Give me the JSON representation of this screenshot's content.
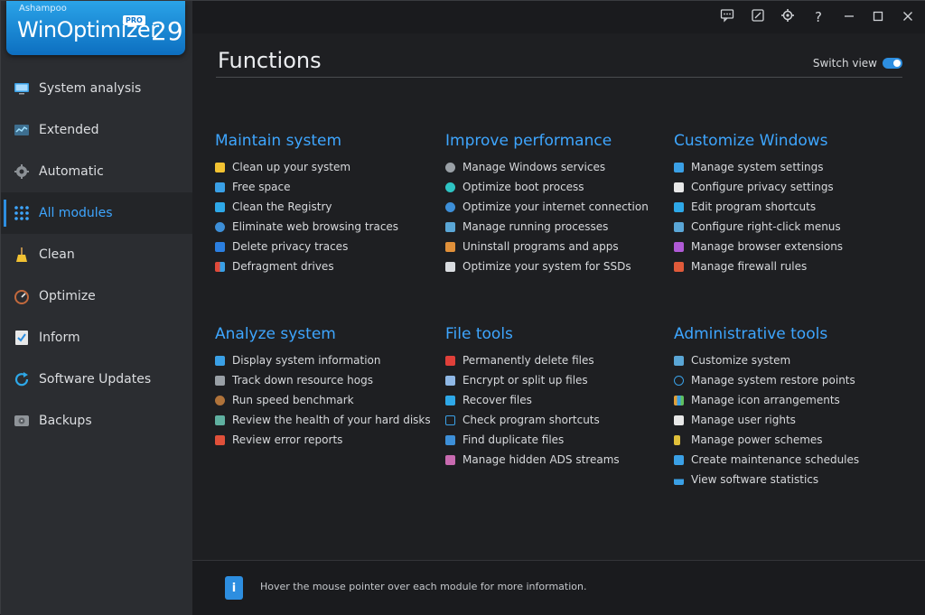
{
  "logo": {
    "brand": "Ashampoo",
    "product": "WinOptimizer",
    "badge": "PRO",
    "version": "29"
  },
  "sidebar": {
    "items": [
      {
        "label": "System analysis",
        "icon": "monitor-icon",
        "active": false
      },
      {
        "label": "Extended",
        "icon": "chart-icon",
        "active": false
      },
      {
        "label": "Automatic",
        "icon": "gear-icon",
        "active": false
      },
      {
        "label": "All modules",
        "icon": "grid-icon",
        "active": true
      },
      {
        "label": "Clean",
        "icon": "broom-icon",
        "active": false
      },
      {
        "label": "Optimize",
        "icon": "speedometer-icon",
        "active": false
      },
      {
        "label": "Inform",
        "icon": "checklist-icon",
        "active": false
      },
      {
        "label": "Software Updates",
        "icon": "refresh-icon",
        "active": false
      },
      {
        "label": "Backups",
        "icon": "drive-icon",
        "active": false
      }
    ]
  },
  "topbar": {
    "icons": [
      "feedback-icon",
      "skin-icon",
      "settings-icon",
      "help-icon",
      "minimize-icon",
      "maximize-icon",
      "close-icon"
    ]
  },
  "main": {
    "title": "Functions",
    "switch_view_label": "Switch view",
    "groups": [
      {
        "title": "Maintain system",
        "items": [
          "Clean up your system",
          "Free space",
          "Clean the Registry",
          "Eliminate web browsing traces",
          "Delete privacy traces",
          "Defragment drives"
        ]
      },
      {
        "title": "Improve performance",
        "items": [
          "Manage Windows services",
          "Optimize boot process",
          "Optimize your internet connection",
          "Manage running processes",
          "Uninstall programs and apps",
          "Optimize your system for SSDs"
        ]
      },
      {
        "title": "Customize Windows",
        "items": [
          "Manage system settings",
          "Configure privacy settings",
          "Edit program shortcuts",
          "Configure right-click menus",
          "Manage browser extensions",
          "Manage firewall rules"
        ]
      },
      {
        "title": "Analyze system",
        "items": [
          "Display system information",
          "Track down resource hogs",
          "Run speed benchmark",
          "Review the health of your hard disks",
          "Review error reports"
        ]
      },
      {
        "title": "File tools",
        "items": [
          "Permanently delete files",
          "Encrypt or split up files",
          "Recover files",
          "Check program shortcuts",
          "Find duplicate files",
          "Manage hidden ADS streams"
        ]
      },
      {
        "title": "Administrative tools",
        "items": [
          "Customize system",
          "Manage system restore points",
          "Manage icon arrangements",
          "Manage user rights",
          "Manage power schemes",
          "Create maintenance schedules",
          "View software statistics"
        ]
      }
    ]
  },
  "footer": {
    "hint": "Hover the mouse pointer over each module for more information."
  },
  "colors": {
    "accent": "#3ea6ff",
    "sidebar_bg": "#2b2d31",
    "main_bg": "#1e1f22",
    "topbar_bg": "#1a1b1e"
  }
}
